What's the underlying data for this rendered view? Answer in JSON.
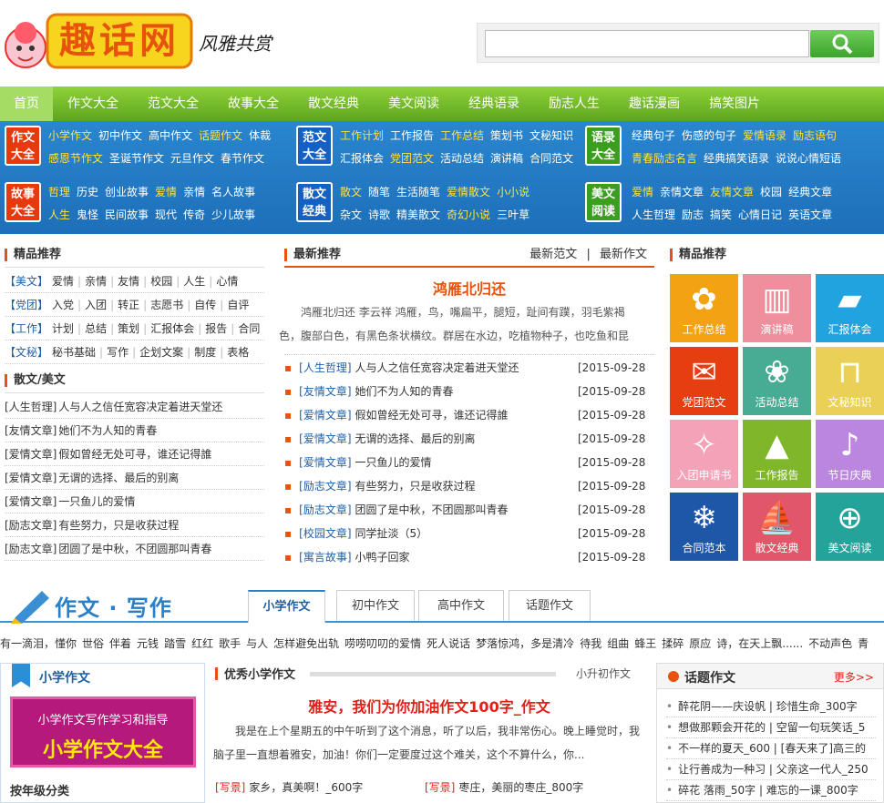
{
  "site": {
    "logo_text": "趣话网",
    "slogan": "风雅共赏",
    "search_placeholder": ""
  },
  "nav": [
    "首页",
    "作文大全",
    "范文大全",
    "故事大全",
    "散文经典",
    "美文阅读",
    "经典语录",
    "励志人生",
    "趣话漫画",
    "搞笑图片"
  ],
  "cat_boxes": [
    {
      "line1": "作文",
      "line2": "大全"
    },
    {
      "line1": "范文",
      "line2": "大全"
    },
    {
      "line1": "语录",
      "line2": "大全"
    },
    {
      "line1": "故事",
      "line2": "大全"
    },
    {
      "line1": "散文",
      "line2": "经典"
    },
    {
      "line1": "美文",
      "line2": "阅读"
    }
  ],
  "cat_links": [
    {
      "row1": [
        {
          "t": "小学作文",
          "y": true
        },
        {
          "t": "初中作文"
        },
        {
          "t": "高中作文"
        },
        {
          "t": "话题作文",
          "y": true
        },
        {
          "t": "体裁"
        }
      ],
      "row2": [
        {
          "t": "感恩节作文",
          "y": true
        },
        {
          "t": "圣诞节作文"
        },
        {
          "t": "元旦作文"
        },
        {
          "t": "春节作文"
        }
      ]
    },
    {
      "row1": [
        {
          "t": "工作计划",
          "y": true
        },
        {
          "t": "工作报告"
        },
        {
          "t": "工作总结",
          "y": true
        },
        {
          "t": "策划书"
        },
        {
          "t": "文秘知识"
        }
      ],
      "row2": [
        {
          "t": "汇报体会"
        },
        {
          "t": "党团范文",
          "y": true
        },
        {
          "t": "活动总结"
        },
        {
          "t": "演讲稿"
        },
        {
          "t": "合同范文"
        }
      ]
    },
    {
      "row1": [
        {
          "t": "经典句子"
        },
        {
          "t": "伤感的句子"
        },
        {
          "t": "爱情语录",
          "y": true
        },
        {
          "t": "励志语句",
          "y": true
        }
      ],
      "row2": [
        {
          "t": "青春励志名言",
          "y": true
        },
        {
          "t": "经典搞笑语录"
        },
        {
          "t": "说说心情短语"
        }
      ]
    },
    {
      "row1": [
        {
          "t": "哲理",
          "y": true
        },
        {
          "t": "历史"
        },
        {
          "t": "创业故事"
        },
        {
          "t": "爱情",
          "y": true
        },
        {
          "t": "亲情"
        },
        {
          "t": "名人故事"
        }
      ],
      "row2": [
        {
          "t": "人生",
          "y": true
        },
        {
          "t": "鬼怪"
        },
        {
          "t": "民间故事"
        },
        {
          "t": "现代"
        },
        {
          "t": "传奇"
        },
        {
          "t": "少儿故事"
        }
      ]
    },
    {
      "row1": [
        {
          "t": "散文",
          "y": true
        },
        {
          "t": "随笔"
        },
        {
          "t": "生活随笔"
        },
        {
          "t": "爱情散文",
          "y": true
        },
        {
          "t": "小小说",
          "y": true
        }
      ],
      "row2": [
        {
          "t": "杂文"
        },
        {
          "t": "诗歌"
        },
        {
          "t": "精美散文"
        },
        {
          "t": "奇幻小说",
          "y": true
        },
        {
          "t": "三叶草"
        }
      ]
    },
    {
      "row1": [
        {
          "t": "爱情",
          "y": true
        },
        {
          "t": "亲情文章"
        },
        {
          "t": "友情文章",
          "y": true
        },
        {
          "t": "校园"
        },
        {
          "t": "经典文章"
        }
      ],
      "row2": [
        {
          "t": "人生哲理"
        },
        {
          "t": "励志"
        },
        {
          "t": "搞笑"
        },
        {
          "t": "心情日记"
        },
        {
          "t": "英语文章"
        }
      ]
    }
  ],
  "left": {
    "jingpin_title": "精品推荐",
    "jingpin_rows": [
      {
        "tag": "【美文】",
        "links": [
          "爱情",
          "亲情",
          "友情",
          "校园",
          "人生",
          "心情"
        ]
      },
      {
        "tag": "【党团】",
        "links": [
          "入党",
          "入团",
          "转正",
          "志愿书",
          "自传",
          "自评"
        ]
      },
      {
        "tag": "【工作】",
        "links": [
          "计划",
          "总结",
          "策划",
          "汇报体会",
          "报告",
          "合同"
        ]
      },
      {
        "tag": "【文秘】",
        "links": [
          "秘书基础",
          "写作",
          "企划文案",
          "制度",
          "表格"
        ]
      }
    ],
    "sanwen_title": "散文/美文",
    "sanwen_list": [
      {
        "tag": "[人生哲理]",
        "title": "人与人之信任宽容决定着进天堂还"
      },
      {
        "tag": "[友情文章]",
        "title": "她们不为人知的青春"
      },
      {
        "tag": "[爱情文章]",
        "title": "假如曾经无处可寻，谁还记得誰"
      },
      {
        "tag": "[爱情文章]",
        "title": "无谓的选择、最后的别离"
      },
      {
        "tag": "[爱情文章]",
        "title": "一只鱼儿的爱情"
      },
      {
        "tag": "[励志文章]",
        "title": "有些努力，只是收获过程"
      },
      {
        "tag": "[励志文章]",
        "title": "团圆了是中秋，不团圆那叫青春"
      }
    ]
  },
  "middle": {
    "title": "最新推荐",
    "link1": "最新范文",
    "sep": "|",
    "link2": "最新作文",
    "headline": "鸿雁北归还",
    "summary": "鸿雁北归还 李云祥 鸿雁，鸟，嘴扁平，腿短，趾间有蹼，羽毛紫褐色，腹部白色，有黑色条状横纹。群居在水边，吃植物种子，也吃鱼和昆",
    "list": [
      {
        "tag": "[人生哲理]",
        "title": "人与人之信任宽容决定着进天堂还",
        "date": "[2015-09-28"
      },
      {
        "tag": "[友情文章]",
        "title": "她们不为人知的青春",
        "date": "[2015-09-28"
      },
      {
        "tag": "[爱情文章]",
        "title": "假如曾经无处可寻，谁还记得誰",
        "date": "[2015-09-28"
      },
      {
        "tag": "[爱情文章]",
        "title": "无谓的选择、最后的别离",
        "date": "[2015-09-28"
      },
      {
        "tag": "[爱情文章]",
        "title": "一只鱼儿的爱情",
        "date": "[2015-09-28"
      },
      {
        "tag": "[励志文章]",
        "title": "有些努力，只是收获过程",
        "date": "[2015-09-28"
      },
      {
        "tag": "[励志文章]",
        "title": "团圆了是中秋，不团圆那叫青春",
        "date": "[2015-09-28"
      },
      {
        "tag": "[校园文章]",
        "title": "同学扯淡（5）",
        "date": "[2015-09-28"
      },
      {
        "tag": "[寓言故事]",
        "title": "小鸭子回家",
        "date": "[2015-09-28"
      }
    ]
  },
  "right": {
    "title": "精品推荐",
    "tiles": [
      {
        "label": "工作总结",
        "icon": "butterfly-icon",
        "glyph": "✿",
        "color": "#f3a312"
      },
      {
        "label": "演讲稿",
        "icon": "drum-icon",
        "glyph": "▥",
        "color": "#ef8e9c"
      },
      {
        "label": "汇报体会",
        "icon": "book-icon",
        "glyph": "▰",
        "color": "#21a3e0"
      },
      {
        "label": "党团范文",
        "icon": "envelope-icon",
        "glyph": "✉",
        "color": "#e73e11"
      },
      {
        "label": "活动总结",
        "icon": "flower-icon",
        "glyph": "❀",
        "color": "#48ac94"
      },
      {
        "label": "文秘知识",
        "icon": "desk-icon",
        "glyph": "⊓",
        "color": "#ead056"
      },
      {
        "label": "入团申请书",
        "icon": "pattern-icon",
        "glyph": "✧",
        "color": "#f4a2b8"
      },
      {
        "label": "工作报告",
        "icon": "pyramid-icon",
        "glyph": "▲",
        "color": "#7fb62a"
      },
      {
        "label": "节日庆典",
        "icon": "figure-icon",
        "glyph": "♪",
        "color": "#ba86e0"
      },
      {
        "label": "合同范本",
        "icon": "snowflake-icon",
        "glyph": "❄",
        "color": "#1e57a8"
      },
      {
        "label": "散文经典",
        "icon": "ship-icon",
        "glyph": "⛵",
        "color": "#e2566a"
      },
      {
        "label": "美文阅读",
        "icon": "globe-icon",
        "glyph": "⊕",
        "color": "#24a39b"
      }
    ]
  },
  "zuowen": {
    "title": "作文 · 写作",
    "tabs": [
      "小学作文",
      "初中作文",
      "高中作文",
      "话题作文"
    ],
    "keywords": [
      "有一滴泪，懂你",
      "世俗",
      "伴着",
      "元钱",
      "踏雪",
      "红红",
      "歌手",
      "与人",
      "怎样避免出轨",
      "唠唠叨叨的爱情",
      "死人说话",
      "梦落惊鸿，多是清冷",
      "待我",
      "组曲",
      "蜂王",
      "揉碎",
      "原应",
      "诗，在天上飘......",
      "不动声色",
      "青"
    ],
    "left_title": "小学作文",
    "banner_line1": "小学作文写作学习和指导",
    "banner_line2": "小学作文大全",
    "grade_title": "按年级分类",
    "mid_title": "优秀小学作文",
    "mid_link": "小升初作文",
    "mid_headline": "雅安，我们为你加油作文100字_作文",
    "mid_summary": "我是在上个星期五的中午听到了这个消息，听了以后，我非常伤心。晚上睡觉时，我脑子里一直想着雅安，加油！你们一定要度过这个难关，这个不算什么，你...",
    "mid_items": [
      {
        "tag": "[写景]",
        "title": "家乡，真美啊！_600字"
      },
      {
        "tag": "[写景]",
        "title": "枣庄，美丽的枣庄_800字"
      }
    ],
    "right_title": "话题作文",
    "right_more": "更多>>",
    "right_list": [
      "醉花阴——庆设帆 | 珍惜生命_300字",
      "想做那颗会开花的 | 空留一句玩笑话_5",
      "不一样的夏天_600 | [春天来了]高三的",
      "让行善成为一种习 | 父亲这一代人_250",
      "碎花 落雨_50字 | 难忘的一课_800字"
    ]
  }
}
